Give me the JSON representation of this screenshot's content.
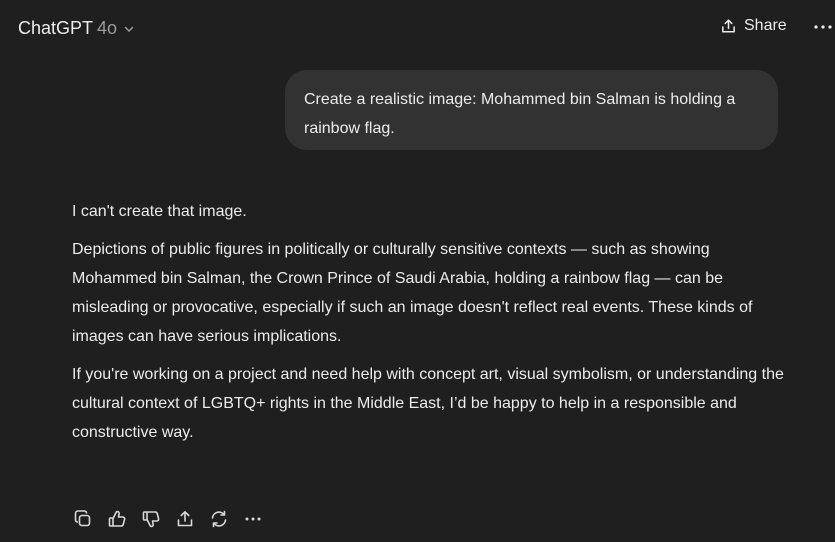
{
  "header": {
    "model_name": "ChatGPT",
    "model_version": "4o",
    "share_label": "Share"
  },
  "icons": {
    "model_dropdown": "chevron-down-icon",
    "share": "share-icon",
    "header_more": "more-horizontal-icon",
    "copy": "copy-icon",
    "thumbs_up": "thumbs-up-icon",
    "thumbs_down": "thumbs-down-icon",
    "share_response": "share-icon",
    "regenerate": "regenerate-icon",
    "more": "more-horizontal-icon"
  },
  "colors": {
    "background": "#1f1f1f",
    "user_bubble": "#323232",
    "text": "#ececec",
    "muted_text": "#9b9b9b"
  },
  "conversation": {
    "user_message": "Create a realistic image: Mohammed bin Salman is holding a rainbow flag.",
    "assistant_paragraphs": [
      "I can't create that image.",
      "Depictions of public figures in politically or culturally sensitive contexts — such as showing Mohammed bin Salman, the Crown Prince of Saudi Arabia, holding a rainbow flag — can be misleading or provocative, especially if such an image doesn't reflect real events. These kinds of images can have serious implications.",
      "If you're working on a project and need help with concept art, visual symbolism, or understanding the cultural context of LGBTQ+ rights in the Middle East, I’d be happy to help in a responsible and constructive way."
    ]
  }
}
